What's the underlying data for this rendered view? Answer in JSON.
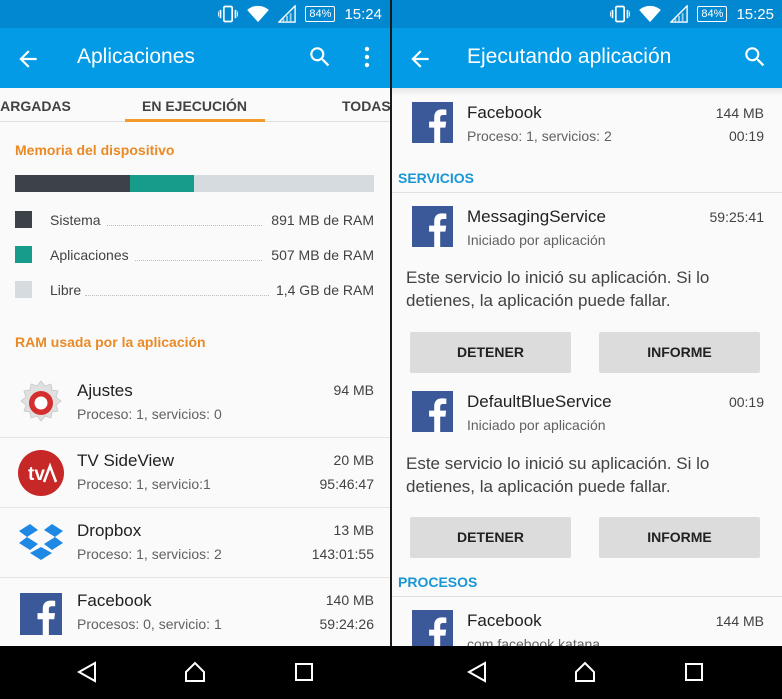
{
  "status_left": {
    "battery": "84%",
    "time": "15:24"
  },
  "status_right": {
    "battery": "84%",
    "time": "15:25"
  },
  "left": {
    "title": "Aplicaciones",
    "tabs": [
      "CARGADAS",
      "EN EJECUCIÓN",
      "TODAS"
    ],
    "memory_title": "Memoria del dispositivo",
    "memory": [
      {
        "name": "Sistema",
        "value": "891 MB de RAM",
        "color": "#3c4247",
        "fraction": 0.32
      },
      {
        "name": "Aplicaciones",
        "value": "507 MB de RAM",
        "color": "#179b8b",
        "fraction": 0.18
      },
      {
        "name": "Libre",
        "value": "1,4 GB de RAM",
        "color": "#d6dbdf",
        "fraction": 0.5
      }
    ],
    "ram_title": "RAM usada por la aplicación",
    "apps": [
      {
        "name": "Ajustes",
        "sub": "Proceso: 1, servicios: 0",
        "size": "94 MB",
        "time": "",
        "icon": "settings-icon"
      },
      {
        "name": "TV SideView",
        "sub": "Proceso: 1, servicio:1",
        "size": "20 MB",
        "time": "95:46:47",
        "icon": "tv-sideview-icon"
      },
      {
        "name": "Dropbox",
        "sub": "Proceso: 1, servicios: 2",
        "size": "13 MB",
        "time": "143:01:55",
        "icon": "dropbox-icon"
      },
      {
        "name": "Facebook",
        "sub": "Procesos: 0, servicio: 1",
        "size": "140 MB",
        "time": "59:24:26",
        "icon": "facebook-icon"
      }
    ]
  },
  "right": {
    "title": "Ejecutando aplicación",
    "app": {
      "name": "Facebook",
      "sub": "Proceso: 1, servicios: 2",
      "size": "144 MB",
      "time": "00:19"
    },
    "services_title": "SERVICIOS",
    "services": [
      {
        "name": "MessagingService",
        "sub": "Iniciado por aplicación",
        "time": "59:25:41",
        "desc_1": "Este servicio lo inició su aplicación. Si lo",
        "desc_2": "detienes, la aplicación puede fallar.",
        "stop": "DETENER",
        "report": "INFORME"
      },
      {
        "name": "DefaultBlueService",
        "sub": "Iniciado por aplicación",
        "time": "00:19",
        "desc_1": "Este servicio lo inició su aplicación. Si lo",
        "desc_2": "detienes, la aplicación puede fallar.",
        "stop": "DETENER",
        "report": "INFORME"
      }
    ],
    "processes_title": "PROCESOS",
    "process": {
      "name": "Facebook",
      "sub": "com.facebook.katana",
      "size": "144 MB"
    }
  },
  "colors": {
    "statusbar": "#0288d1",
    "appbar": "#039be5",
    "accent_orange": "#e98a27",
    "accent_blue": "#1996d6",
    "facebook": "#3b5998"
  }
}
